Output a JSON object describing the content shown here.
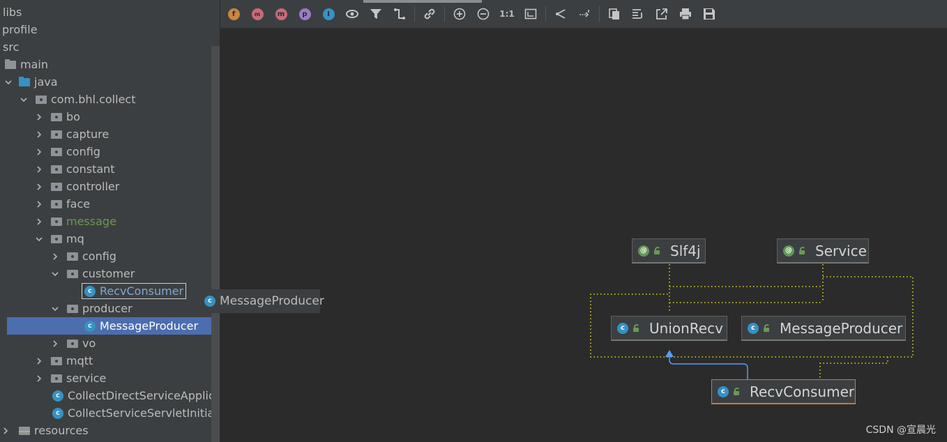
{
  "tree": {
    "rows": [
      {
        "label": "libs"
      },
      {
        "label": "profile"
      },
      {
        "label": "src"
      },
      {
        "label": "main"
      },
      {
        "label": "java"
      },
      {
        "label": "com.bhl.collect"
      },
      {
        "label": "bo"
      },
      {
        "label": "capture"
      },
      {
        "label": "config"
      },
      {
        "label": "constant"
      },
      {
        "label": "controller"
      },
      {
        "label": "face"
      },
      {
        "label": "message"
      },
      {
        "label": "mq"
      },
      {
        "label": "config"
      },
      {
        "label": "customer"
      },
      {
        "label": "RecvConsumer"
      },
      {
        "label": "producer"
      },
      {
        "label": "MessageProducer"
      },
      {
        "label": "vo"
      },
      {
        "label": "mqtt"
      },
      {
        "label": "service"
      },
      {
        "label": "CollectDirectServiceApplicati"
      },
      {
        "label": "CollectServiceServletInitialize"
      },
      {
        "label": "resources"
      }
    ]
  },
  "drag_ghost": {
    "label": "MessageProducer"
  },
  "toolbar": {
    "icons": [
      "fields-icon",
      "methods-icon",
      "properties-icon",
      "package-icon",
      "inner-classes-icon",
      "visibility-icon",
      "filter-icon",
      "edge-icon",
      "link-icon",
      "zoom-in-icon",
      "zoom-out-icon",
      "actual-size-icon",
      "fit-content-icon",
      "layout-icon",
      "apply-layout-icon",
      "copy-icon",
      "export-text-icon",
      "export-icon",
      "print-icon",
      "save-icon"
    ],
    "actual_size_label": "1:1",
    "letters": {
      "f": "f",
      "m1": "m",
      "m2": "m",
      "p": "p",
      "i": "I"
    }
  },
  "diagram": {
    "nodes": {
      "slf4j": {
        "label": "Slf4j",
        "kind": "annotation"
      },
      "service": {
        "label": "Service",
        "kind": "annotation"
      },
      "union_recv": {
        "label": "UnionRecv",
        "kind": "interface"
      },
      "message_producer": {
        "label": "MessageProducer",
        "kind": "class"
      },
      "recv_consumer": {
        "label": "RecvConsumer",
        "kind": "class"
      }
    },
    "icon_letters": {
      "annotation": "@",
      "class": "c",
      "interface": "c"
    }
  },
  "watermark": "CSDN @宣晨光",
  "colors": {
    "background": "#2b2b2b",
    "panel": "#3c3f41",
    "selection": "#4b6eaf",
    "class_icon": "#3592c4",
    "annotation_icon": "#629755",
    "dependency_line": "#b5b51a",
    "inheritance_line": "#589df6",
    "selected_border": "#c77a3e"
  }
}
